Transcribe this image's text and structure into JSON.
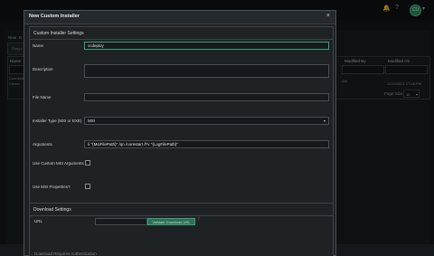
{
  "topbar": {
    "icons": [
      "bell-icon",
      "help-icon",
      "settings-icon"
    ],
    "avatar_initials": "CU"
  },
  "background": {
    "tabs": [
      "New",
      "E"
    ],
    "filter_label": "Drag c",
    "columns": [
      "Name",
      "Modified By",
      "Modified On"
    ],
    "row": {
      "name_line1": "Connecte",
      "name_line2": "Center",
      "modified_by": "AM",
      "modified_on": "11/15/2021 07:46 PM"
    },
    "page_size_label": "Page Size:",
    "page_size_value": "10"
  },
  "modal": {
    "title": "New Custom Installer",
    "close_glyph": "×",
    "settings_section_title": "Custom Installer Settings",
    "fields": {
      "name_label": "Name",
      "name_value": "ccdeploy",
      "description_label": "Description",
      "description_value": "",
      "file_name_label": "File Name",
      "file_name_value": "",
      "installer_type_label": "Installer Type (MSI or EXE)",
      "installer_type_value": "MSI",
      "arguments_label": "Arguments",
      "arguments_value": "/i \"{MsiFilePath}\" /qn /norestart /l*v \"{LogFilePath}\"",
      "custom_msi_label": "Use Custom MSI Arguments",
      "msi_props_label": "Use MSI Properties?"
    },
    "download_section_title": "Download Settings",
    "download": {
      "url_label": "URL",
      "url_value": "",
      "url_button": "Validate Download URL",
      "required_glyph": "!",
      "next_label": "Download Requires Authentication"
    }
  }
}
